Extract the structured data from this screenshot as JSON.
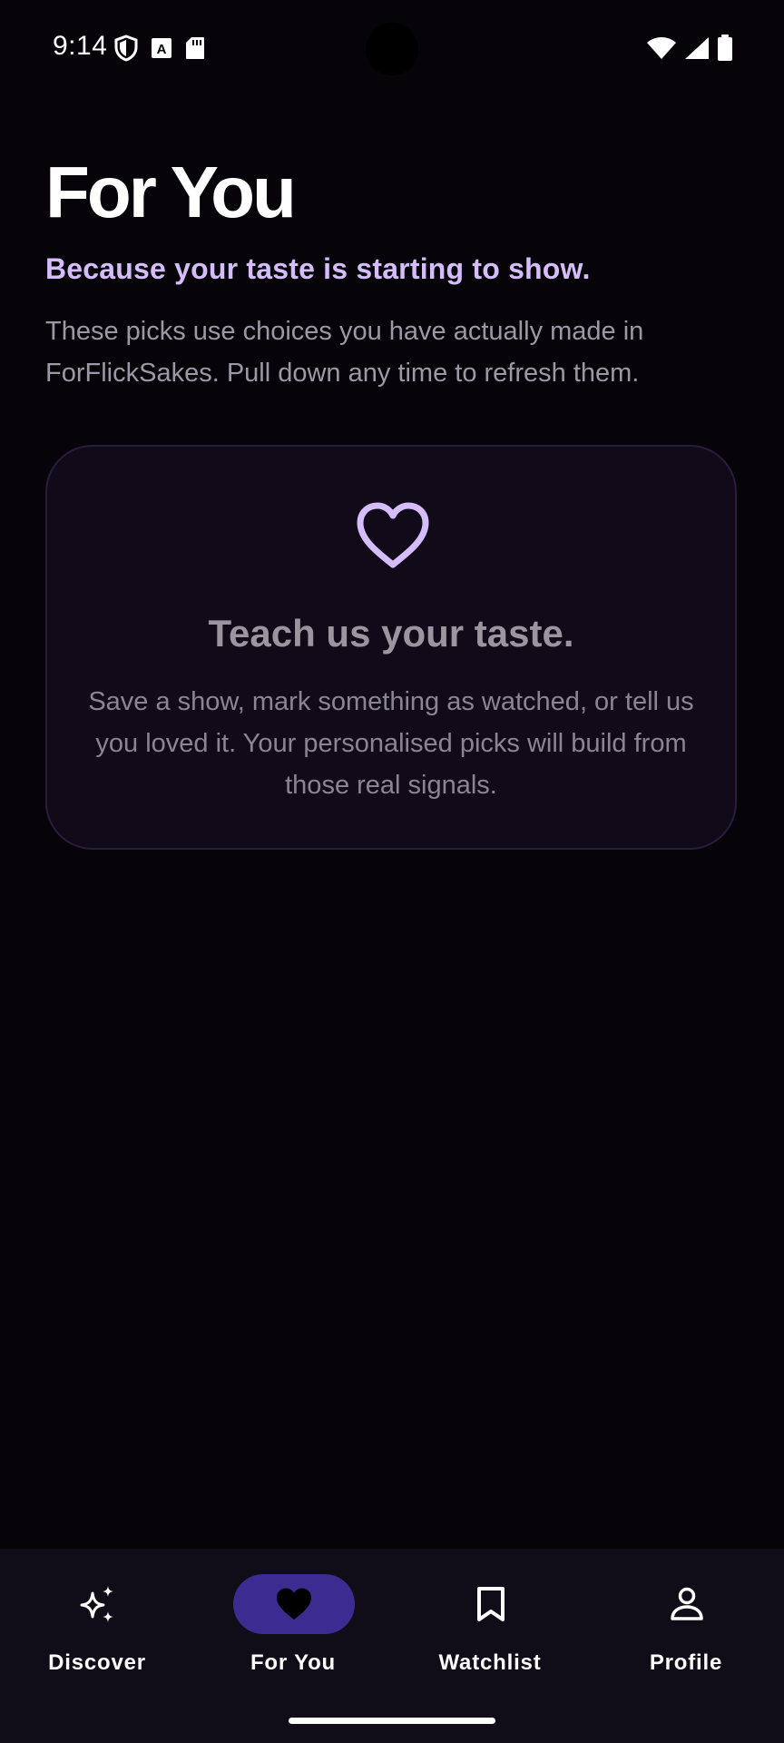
{
  "status": {
    "time": "9:14",
    "icons_left": [
      "shield-icon",
      "font-a-icon",
      "sd-card-icon"
    ],
    "icons_right": [
      "wifi-icon",
      "cellular-icon",
      "battery-icon"
    ]
  },
  "header": {
    "title": "For You",
    "tagline": "Because your taste is starting to show.",
    "intro": "These picks use choices you have actually made in ForFlickSakes. Pull down any time to refresh them."
  },
  "empty_state": {
    "icon": "heart-outline-icon",
    "title": "Teach us your taste.",
    "body": "Save a show, mark something as watched, or tell us you loved it. Your personalised picks will build from those real signals."
  },
  "nav": {
    "items": [
      {
        "label": "Discover",
        "icon": "sparkles-icon",
        "active": false
      },
      {
        "label": "For You",
        "icon": "heart-filled-icon",
        "active": true
      },
      {
        "label": "Watchlist",
        "icon": "bookmark-icon",
        "active": false
      },
      {
        "label": "Profile",
        "icon": "person-icon",
        "active": false
      }
    ]
  },
  "colors": {
    "background": "#060409",
    "accent": "#d4bdfa",
    "active_pill": "#3c2b91",
    "card": "#110a19",
    "card_border": "#2c1b3d"
  }
}
